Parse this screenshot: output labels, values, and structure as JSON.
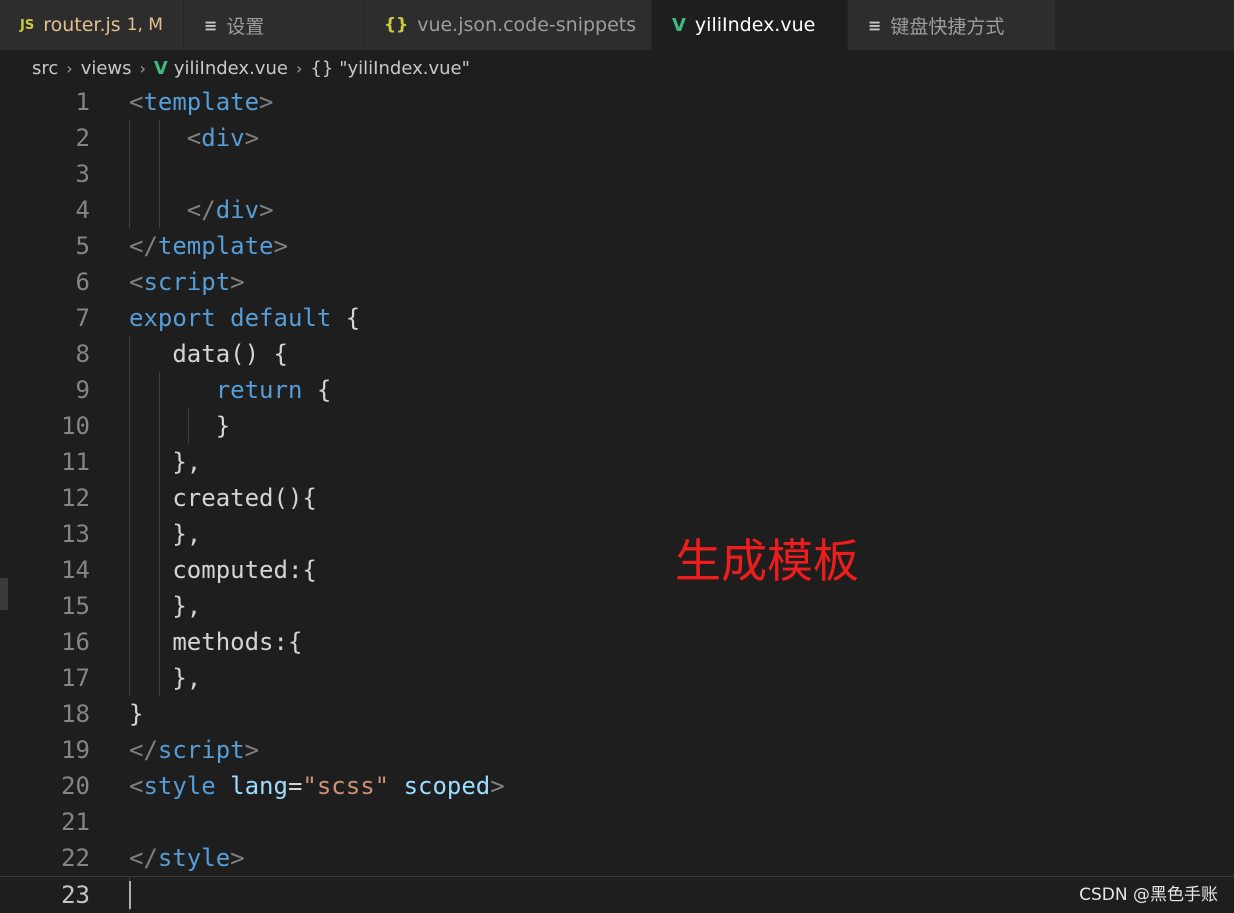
{
  "tabs": [
    {
      "icon": "js-file-icon",
      "icon_text": "JS",
      "label": "router.js",
      "status": "1, M",
      "active": false
    },
    {
      "icon": "settings-lines-icon",
      "icon_text": "≡",
      "label": "设置",
      "active": false
    },
    {
      "icon": "json-braces-icon",
      "icon_text": "{}",
      "label": "vue.json.code-snippets",
      "active": false
    },
    {
      "icon": "vue-file-icon",
      "icon_text": "V",
      "label": "yiliIndex.vue",
      "active": true,
      "dirty": true
    },
    {
      "icon": "keyboard-lines-icon",
      "icon_text": "≡",
      "label": "键盘快捷方式",
      "active": false
    }
  ],
  "breadcrumb": {
    "items": [
      "src",
      "views",
      "yiliIndex.vue",
      "\"yiliIndex.vue\""
    ],
    "vue_icon": "V",
    "braces_icon": "{}",
    "separator": "›"
  },
  "editor": {
    "current_line": 23,
    "lines": [
      {
        "n": "1",
        "tokens": [
          [
            "<",
            "t-punc"
          ],
          [
            "template",
            "t-tag"
          ],
          [
            ">",
            "t-punc"
          ]
        ]
      },
      {
        "n": "2",
        "tokens": [
          [
            "    ",
            "t-text"
          ],
          [
            "<",
            "t-punc"
          ],
          [
            "div",
            "t-tag"
          ],
          [
            ">",
            "t-punc"
          ]
        ]
      },
      {
        "n": "3",
        "tokens": []
      },
      {
        "n": "4",
        "tokens": [
          [
            "    ",
            "t-text"
          ],
          [
            "</",
            "t-punc"
          ],
          [
            "div",
            "t-tag"
          ],
          [
            ">",
            "t-punc"
          ]
        ]
      },
      {
        "n": "5",
        "tokens": [
          [
            "</",
            "t-punc"
          ],
          [
            "template",
            "t-tag"
          ],
          [
            ">",
            "t-punc"
          ]
        ]
      },
      {
        "n": "6",
        "tokens": [
          [
            "<",
            "t-punc"
          ],
          [
            "script",
            "t-tag"
          ],
          [
            ">",
            "t-punc"
          ]
        ]
      },
      {
        "n": "7",
        "tokens": [
          [
            "export",
            "t-kw"
          ],
          [
            " ",
            "t-text"
          ],
          [
            "default",
            "t-kw"
          ],
          [
            " {",
            "t-text"
          ]
        ]
      },
      {
        "n": "8",
        "tokens": [
          [
            "   data() {",
            "t-text"
          ]
        ]
      },
      {
        "n": "9",
        "tokens": [
          [
            "      ",
            "t-text"
          ],
          [
            "return",
            "t-kw"
          ],
          [
            " {",
            "t-text"
          ]
        ]
      },
      {
        "n": "10",
        "tokens": [
          [
            "      }",
            "t-text"
          ]
        ]
      },
      {
        "n": "11",
        "tokens": [
          [
            "   },",
            "t-text"
          ]
        ]
      },
      {
        "n": "12",
        "tokens": [
          [
            "   created(){",
            "t-text"
          ]
        ]
      },
      {
        "n": "13",
        "tokens": [
          [
            "   },",
            "t-text"
          ]
        ]
      },
      {
        "n": "14",
        "tokens": [
          [
            "   computed:{",
            "t-text"
          ]
        ]
      },
      {
        "n": "15",
        "tokens": [
          [
            "   },",
            "t-text"
          ]
        ]
      },
      {
        "n": "16",
        "tokens": [
          [
            "   methods:{",
            "t-text"
          ]
        ]
      },
      {
        "n": "17",
        "tokens": [
          [
            "   },",
            "t-text"
          ]
        ]
      },
      {
        "n": "18",
        "tokens": [
          [
            "}",
            "t-text"
          ]
        ]
      },
      {
        "n": "19",
        "tokens": [
          [
            "</",
            "t-punc"
          ],
          [
            "script",
            "t-tag"
          ],
          [
            ">",
            "t-punc"
          ]
        ]
      },
      {
        "n": "20",
        "tokens": [
          [
            "<",
            "t-punc"
          ],
          [
            "style",
            "t-tag"
          ],
          [
            " ",
            "t-text"
          ],
          [
            "lang",
            "t-attr"
          ],
          [
            "=",
            "t-text"
          ],
          [
            "\"scss\"",
            "t-str"
          ],
          [
            " ",
            "t-text"
          ],
          [
            "scoped",
            "t-attr"
          ],
          [
            ">",
            "t-punc"
          ]
        ]
      },
      {
        "n": "21",
        "tokens": []
      },
      {
        "n": "22",
        "tokens": [
          [
            "</",
            "t-punc"
          ],
          [
            "style",
            "t-tag"
          ],
          [
            ">",
            "t-punc"
          ]
        ]
      },
      {
        "n": "23",
        "tokens": []
      }
    ]
  },
  "annotation": "生成模板",
  "watermark": "CSDN @黑色手账",
  "colors": {
    "background": "#1e1e1e",
    "tag": "#569cd6",
    "keyword": "#569cd6",
    "attribute": "#9cdcfe",
    "string": "#ce9178",
    "annotation": "#ee1d1d",
    "vue_icon": "#41b883",
    "modified": "#e2c08d"
  }
}
